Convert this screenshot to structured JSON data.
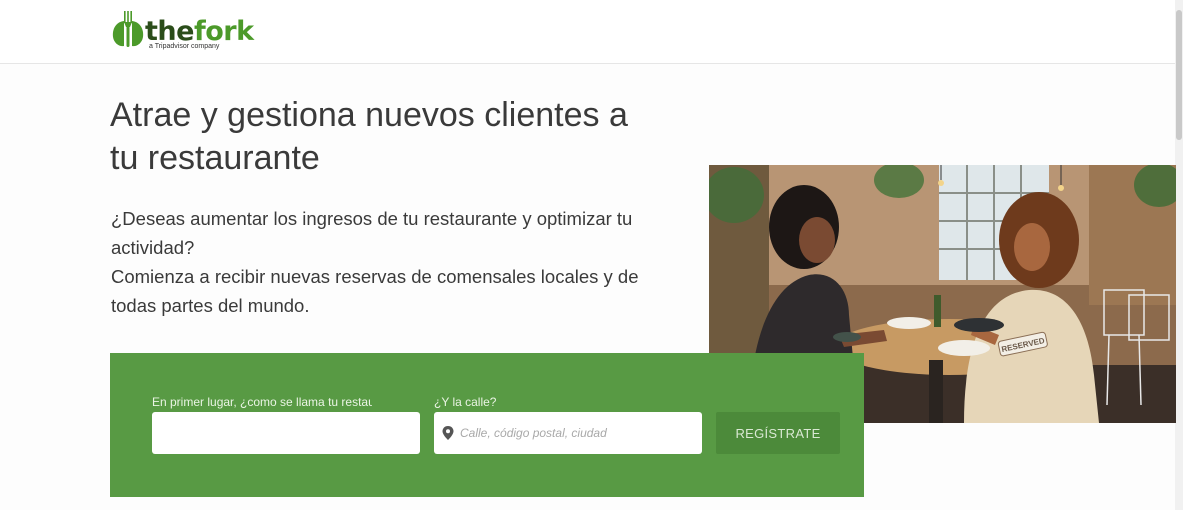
{
  "brand": {
    "logo_icon": "fork-logo-icon",
    "name_part1": "the",
    "name_part2": "fork",
    "tagline": "a Tripadvisor company",
    "colors": {
      "dark_green": "#2b4d1a",
      "green": "#4c9a2a"
    }
  },
  "hero": {
    "title": "Atrae y gestiona nuevos clientes a tu restaurante",
    "paragraph1": "¿Deseas aumentar los ingresos de tu restaurante y optimizar tu actividad?",
    "paragraph2": "Comienza a recibir nuevas reservas de comensales locales y de todas partes del mundo.",
    "photo_sign": "RESERVED"
  },
  "signup": {
    "background_color": "#589a44",
    "name_label": "En primer lugar, ¿como se llama tu restaurante?",
    "name_value": "",
    "street_label": "¿Y la calle?",
    "street_placeholder": "Calle, código postal, ciudad",
    "street_icon": "map-pin-icon",
    "register_label": "REGÍSTRATE"
  }
}
